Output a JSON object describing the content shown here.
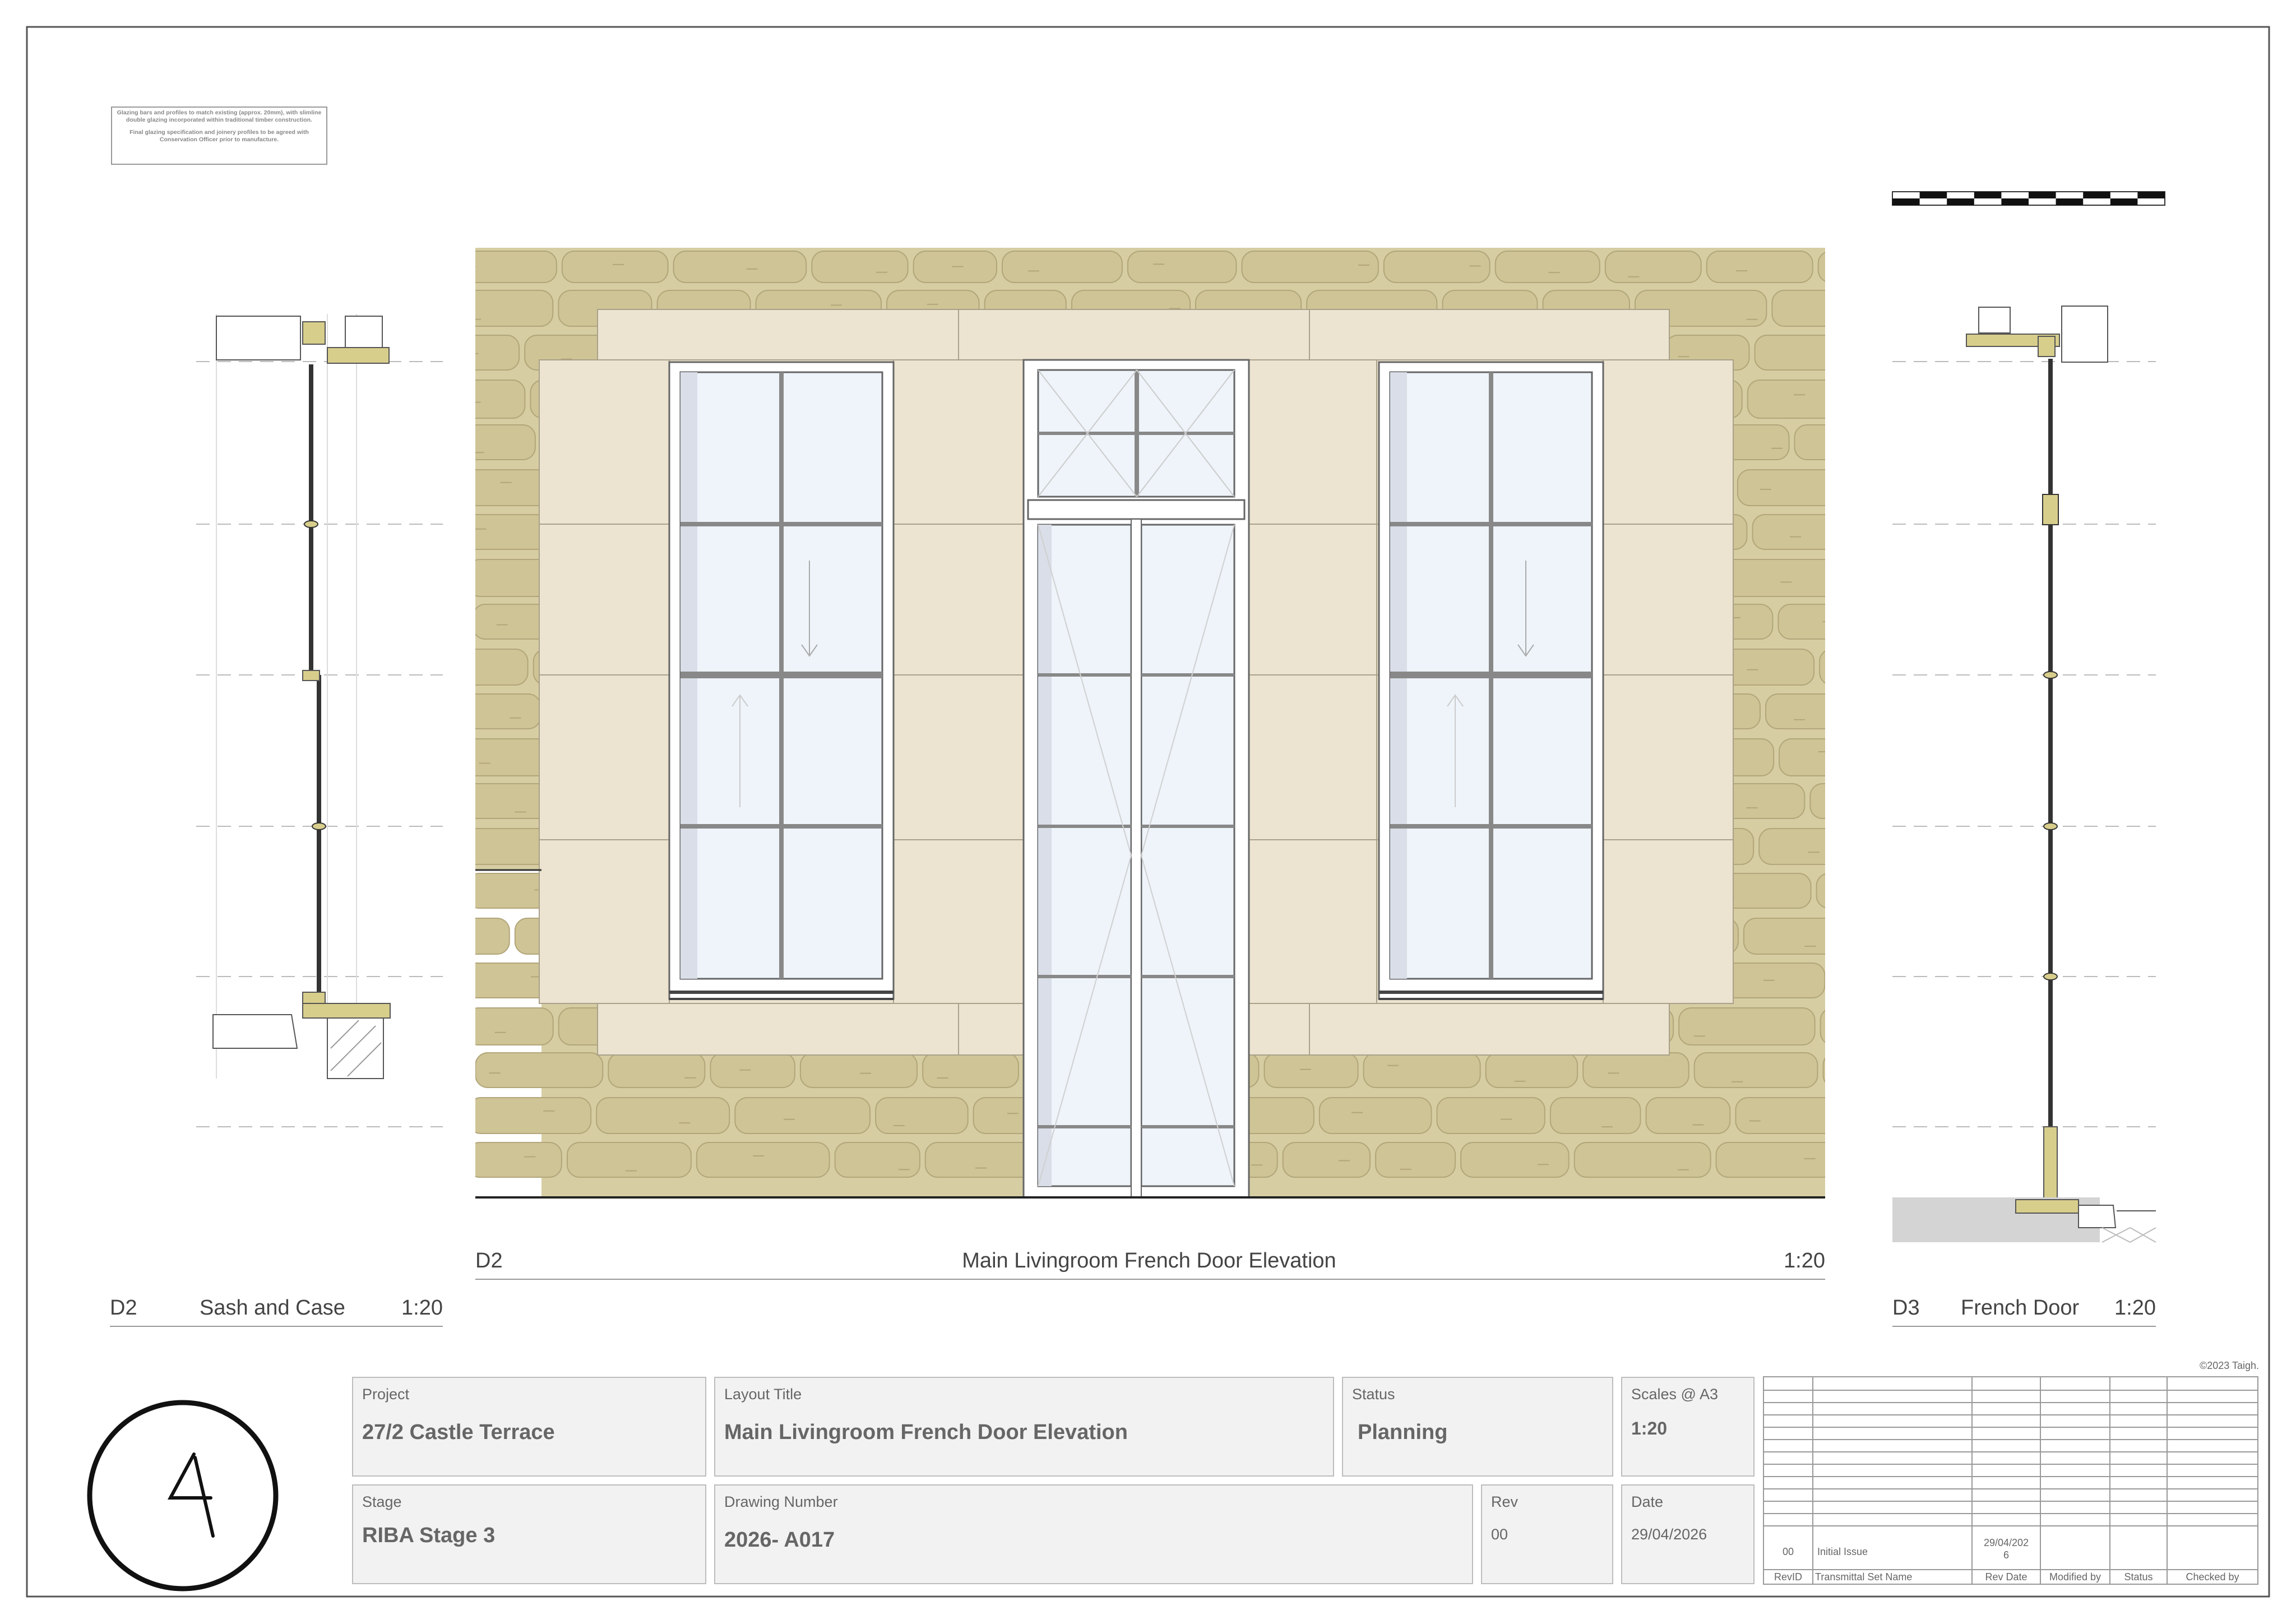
{
  "note": {
    "line1": "Glazing bars and profiles to match existing (approx. 20mm), with slimline double glazing incorporated within traditional timber construction.",
    "line2": "Final glazing specification and joinery profiles to be agreed with Conservation Officer prior to manufacture."
  },
  "views": {
    "main": {
      "ref": "D2",
      "title": "Main Livingroom French Door Elevation",
      "scale": "1:20"
    },
    "left": {
      "ref": "D2",
      "title": "Sash and Case",
      "scale": "1:20"
    },
    "right": {
      "ref": "D3",
      "title": "French Door",
      "scale": "1:20"
    }
  },
  "copyright": "©2023 Taigh.",
  "title_block": {
    "project_label": "Project",
    "project": "27/2 Castle Terrace",
    "layout_label": "Layout Title",
    "layout": "Main Livingroom French Door Elevation",
    "status_label": "Status",
    "status": "Planning",
    "scales_label": "Scales @ A3",
    "scales": "1:20",
    "stage_label": "Stage",
    "stage": "RIBA Stage 3",
    "drawing_label": "Drawing Number",
    "drawing": "2026- A017",
    "rev_label": "Rev",
    "rev": "00",
    "date_label": "Date",
    "date": "29/04/2026"
  },
  "revisions": {
    "headers": [
      "RevID",
      "Transmittal Set Name",
      "Rev Date",
      "Modified by",
      "Status",
      "Checked by"
    ],
    "rows": [
      {
        "id": "00",
        "name": "Initial Issue",
        "date_line1": "29/04/202",
        "date_line2": "6"
      }
    ]
  },
  "colors": {
    "stone_bg": "#d6cda3",
    "stone_block": "#cfc495",
    "ashlar": "#ece4d0",
    "glass": "#eef4fa",
    "timber": "#d8ce8c",
    "frame": "#555555"
  },
  "logo": {
    "icon": "taigh-logo-icon"
  }
}
